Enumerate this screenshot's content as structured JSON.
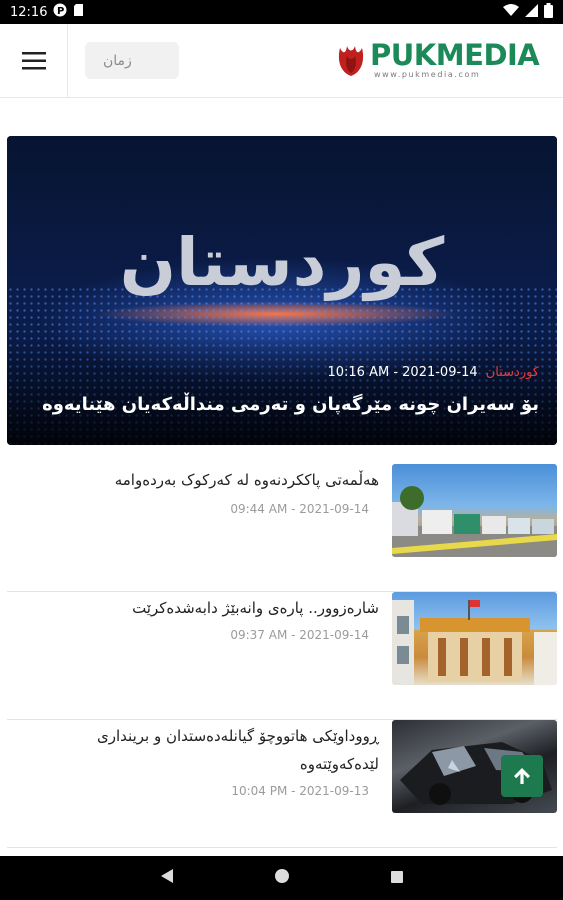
{
  "status": {
    "time": "12:16"
  },
  "header": {
    "language_button": "زمان",
    "logo_text": "PUKMEDIA",
    "logo_url": "www.pukmedia.com"
  },
  "hero": {
    "image_word": "کوردستان",
    "category": "کوردستان",
    "datetime": "10:16 AM - 2021-09-14",
    "title": "بۆ سەیران چونە مێرگەپان و تەرمی منداڵەکەیان هێنایەوە"
  },
  "news": [
    {
      "title": "هەڵمەتی پاککردنەوە لە کەرکوک بەردەوامە",
      "datetime": "09:44 AM - 2021-09-14"
    },
    {
      "title": "شارەزوور.. پارەی وانەبێژ دابەشدەکرێت",
      "datetime": "09:37 AM - 2021-09-14"
    },
    {
      "title": "ڕووداوێکی هاتووچۆ گیانلەدەستدان و بریندارى لێدەکەوێتەوە",
      "datetime": "10:04 PM - 2021-09-13"
    }
  ],
  "colors": {
    "brand": "#1c8a58",
    "accent_red": "#e43a3a",
    "fab": "#1d7a4e"
  },
  "icons": [
    "status-p-icon",
    "sd-icon",
    "wifi-icon",
    "signal-icon",
    "battery-icon",
    "hamburger-menu-icon",
    "tulip-logo-icon",
    "arrow-up-icon",
    "back-icon",
    "home-icon",
    "recents-icon"
  ]
}
